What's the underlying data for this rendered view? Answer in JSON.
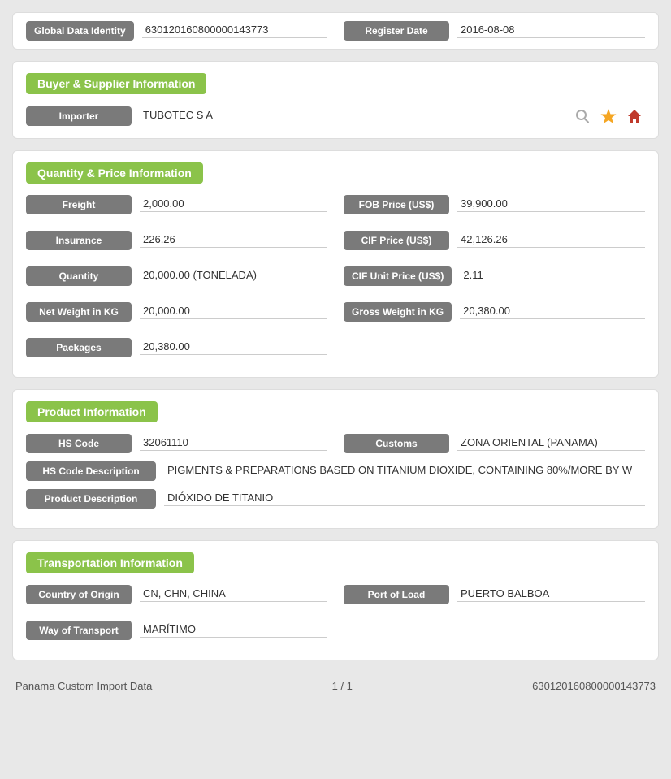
{
  "top": {
    "global_data_label": "Global Data Identity",
    "global_data_value": "630120160800000143773",
    "register_date_label": "Register Date",
    "register_date_value": "2016-08-08"
  },
  "buyer_supplier": {
    "section_title": "Buyer & Supplier Information",
    "importer_label": "Importer",
    "importer_value": "TUBOTEC S A"
  },
  "quantity_price": {
    "section_title": "Quantity & Price Information",
    "freight_label": "Freight",
    "freight_value": "2,000.00",
    "fob_price_label": "FOB Price (US$)",
    "fob_price_value": "39,900.00",
    "insurance_label": "Insurance",
    "insurance_value": "226.26",
    "cif_price_label": "CIF Price (US$)",
    "cif_price_value": "42,126.26",
    "quantity_label": "Quantity",
    "quantity_value": "20,000.00 (TONELADA)",
    "cif_unit_label": "CIF Unit Price (US$)",
    "cif_unit_value": "2.11",
    "net_weight_label": "Net Weight in KG",
    "net_weight_value": "20,000.00",
    "gross_weight_label": "Gross Weight in KG",
    "gross_weight_value": "20,380.00",
    "packages_label": "Packages",
    "packages_value": "20,380.00"
  },
  "product": {
    "section_title": "Product Information",
    "hs_code_label": "HS Code",
    "hs_code_value": "32061110",
    "customs_label": "Customs",
    "customs_value": "ZONA ORIENTAL (PANAMA)",
    "hs_desc_label": "HS Code Description",
    "hs_desc_value": "PIGMENTS & PREPARATIONS BASED ON TITANIUM DIOXIDE, CONTAINING 80%/MORE BY W",
    "product_desc_label": "Product Description",
    "product_desc_value": "DIÓXIDO DE TITANIO"
  },
  "transportation": {
    "section_title": "Transportation Information",
    "country_origin_label": "Country of Origin",
    "country_origin_value": "CN, CHN, CHINA",
    "port_of_load_label": "Port of Load",
    "port_of_load_value": "PUERTO BALBOA",
    "way_of_transport_label": "Way of Transport",
    "way_of_transport_value": "MARÍTIMO"
  },
  "footer": {
    "source": "Panama Custom Import Data",
    "pagination": "1 / 1",
    "id": "630120160800000143773"
  }
}
